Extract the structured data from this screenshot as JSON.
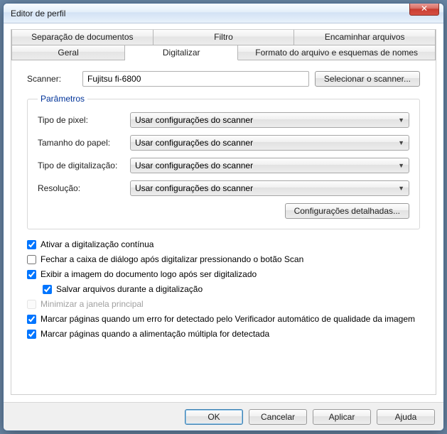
{
  "window": {
    "title": "Editor de perfil"
  },
  "tabs": {
    "row1": [
      {
        "label": "Separação de documentos"
      },
      {
        "label": "Filtro"
      },
      {
        "label": "Encaminhar arquivos"
      }
    ],
    "row2": [
      {
        "label": "Geral"
      },
      {
        "label": "Digitalizar",
        "active": true
      },
      {
        "label": "Formato do arquivo e esquemas de nomes"
      }
    ]
  },
  "scanner": {
    "label": "Scanner:",
    "value": "Fujitsu fi-6800",
    "select_button": "Selecionar o scanner..."
  },
  "params": {
    "legend": "Parâmetros",
    "rows": [
      {
        "label": "Tipo de pixel:",
        "value": "Usar configurações do scanner"
      },
      {
        "label": "Tamanho do papel:",
        "value": "Usar configurações do scanner"
      },
      {
        "label": "Tipo de digitalização:",
        "value": "Usar configurações do scanner"
      },
      {
        "label": "Resolução:",
        "value": "Usar configurações do scanner"
      }
    ],
    "details_button": "Configurações detalhadas..."
  },
  "checks": {
    "continuous": {
      "label": "Ativar a digitalização contínua",
      "checked": true
    },
    "close_dialog": {
      "label": "Fechar a caixa de diálogo após digitalizar pressionando o botão Scan",
      "checked": false
    },
    "show_image": {
      "label": "Exibir a imagem do documento logo após ser digitalizado",
      "checked": true
    },
    "save_during": {
      "label": "Salvar arquivos durante a digitalização",
      "checked": true
    },
    "minimize": {
      "label": "Minimizar a janela principal",
      "checked": false,
      "disabled": true
    },
    "mark_quality": {
      "label": "Marcar páginas quando um erro for detectado pelo Verificador automático de qualidade da imagem",
      "checked": true
    },
    "mark_multifeed": {
      "label": "Marcar páginas quando a alimentação múltipla for detectada",
      "checked": true
    }
  },
  "buttons": {
    "ok": "OK",
    "cancel": "Cancelar",
    "apply": "Aplicar",
    "help": "Ajuda"
  }
}
